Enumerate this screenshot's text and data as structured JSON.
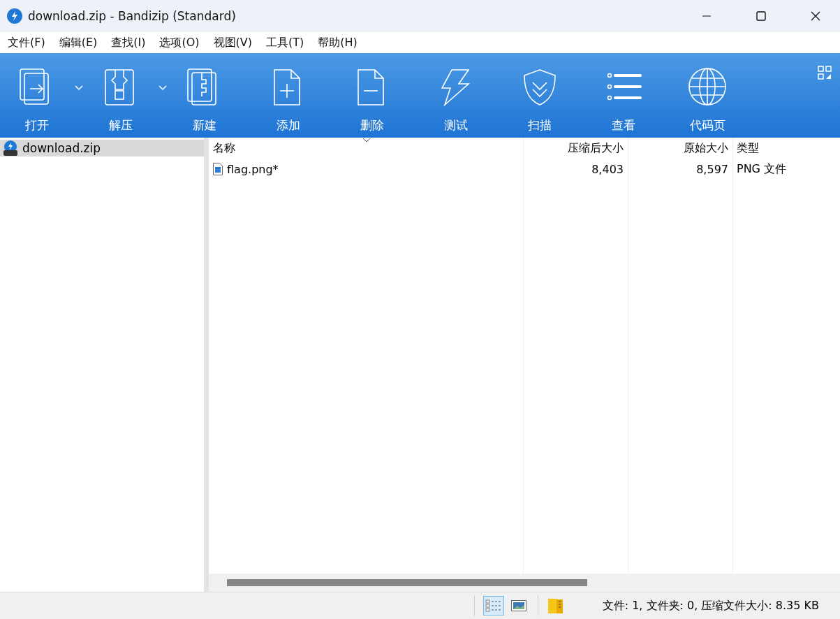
{
  "window": {
    "title": "download.zip - Bandizip (Standard)"
  },
  "menu": [
    "文件(F)",
    "编辑(E)",
    "查找(I)",
    "选项(O)",
    "视图(V)",
    "工具(T)",
    "帮助(H)"
  ],
  "toolbar": [
    {
      "label": "打开",
      "kind": "open",
      "dropdown": true
    },
    {
      "label": "解压",
      "kind": "extract",
      "dropdown": true
    },
    {
      "label": "新建",
      "kind": "new",
      "dropdown": false
    },
    {
      "label": "添加",
      "kind": "add",
      "dropdown": false
    },
    {
      "label": "删除",
      "kind": "delete",
      "dropdown": false
    },
    {
      "label": "测试",
      "kind": "test",
      "dropdown": false
    },
    {
      "label": "扫描",
      "kind": "scan",
      "dropdown": false
    },
    {
      "label": "查看",
      "kind": "view",
      "dropdown": false
    },
    {
      "label": "代码页",
      "kind": "codepage",
      "dropdown": false
    }
  ],
  "sidebar": {
    "items": [
      {
        "label": "download.zip",
        "selected": true
      }
    ]
  },
  "table": {
    "columns": [
      "名称",
      "压缩后大小",
      "原始大小",
      "类型"
    ],
    "rows": [
      {
        "cells": [
          "flag.png*",
          "8,403",
          "8,597",
          "PNG 文件"
        ],
        "selected": false
      }
    ]
  },
  "status_bar": {
    "views": [
      {
        "kind": "details",
        "selected": true
      },
      {
        "kind": "thumbnails",
        "selected": false
      }
    ],
    "text": "文件: 1, 文件夹: 0, 压缩文件大小: 8.35 KB"
  }
}
